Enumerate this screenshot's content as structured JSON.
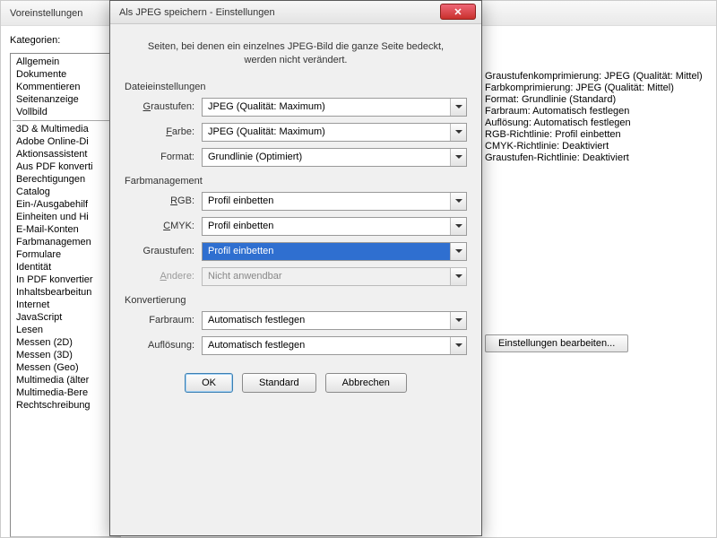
{
  "prefs": {
    "title": "Voreinstellungen",
    "categories_label": "Kategorien:",
    "top_categories": [
      "Allgemein",
      "Dokumente",
      "Kommentieren",
      "Seitenanzeige",
      "Vollbild"
    ],
    "more_categories": [
      "3D & Multimedia",
      "Adobe Online-Di",
      "Aktionsassistent",
      "Aus PDF konverti",
      "Berechtigungen",
      "Catalog",
      "Ein-/Ausgabehilf",
      "Einheiten und Hi",
      "E-Mail-Konten",
      "Farbmanagemen",
      "Formulare",
      "Identität",
      "In PDF konvertier",
      "Inhaltsbearbeitun",
      "Internet",
      "JavaScript",
      "Lesen",
      "Messen (2D)",
      "Messen (3D)",
      "Messen (Geo)",
      "Multimedia (älter",
      "Multimedia-Bere",
      "Rechtschreibung"
    ]
  },
  "summary": {
    "lines": [
      "Graustufenkomprimierung: JPEG (Qualität: Mittel)",
      "Farbkomprimierung: JPEG (Qualität: Mittel)",
      "Format: Grundlinie (Standard)",
      "Farbraum: Automatisch festlegen",
      "Auflösung: Automatisch festlegen",
      "RGB-Richtlinie: Profil einbetten",
      "CMYK-Richtlinie: Deaktiviert",
      "Graustufen-Richtlinie: Deaktiviert"
    ],
    "edit_button": "Einstellungen bearbeiten..."
  },
  "dlg": {
    "title": "Als JPEG speichern - Einstellungen",
    "info": "Seiten, bei denen ein einzelnes JPEG-Bild die ganze Seite bedeckt, werden nicht verändert.",
    "groups": {
      "file": {
        "title": "Dateieinstellungen",
        "gray_label": "Graustufen:",
        "gray_value": "JPEG (Qualität: Maximum)",
        "color_label": "Farbe:",
        "color_value": "JPEG (Qualität: Maximum)",
        "format_label": "Format:",
        "format_value": "Grundlinie (Optimiert)"
      },
      "cm": {
        "title": "Farbmanagement",
        "rgb_label": "RGB:",
        "rgb_value": "Profil einbetten",
        "cmyk_label": "CMYK:",
        "cmyk_value": "Profil einbetten",
        "gray_label": "Graustufen:",
        "gray_value": "Profil einbetten",
        "other_label": "Andere:",
        "other_value": "Nicht anwendbar"
      },
      "conv": {
        "title": "Konvertierung",
        "space_label": "Farbraum:",
        "space_value": "Automatisch festlegen",
        "res_label": "Auflösung:",
        "res_value": "Automatisch festlegen"
      }
    },
    "buttons": {
      "ok": "OK",
      "standard": "Standard",
      "cancel": "Abbrechen"
    }
  }
}
